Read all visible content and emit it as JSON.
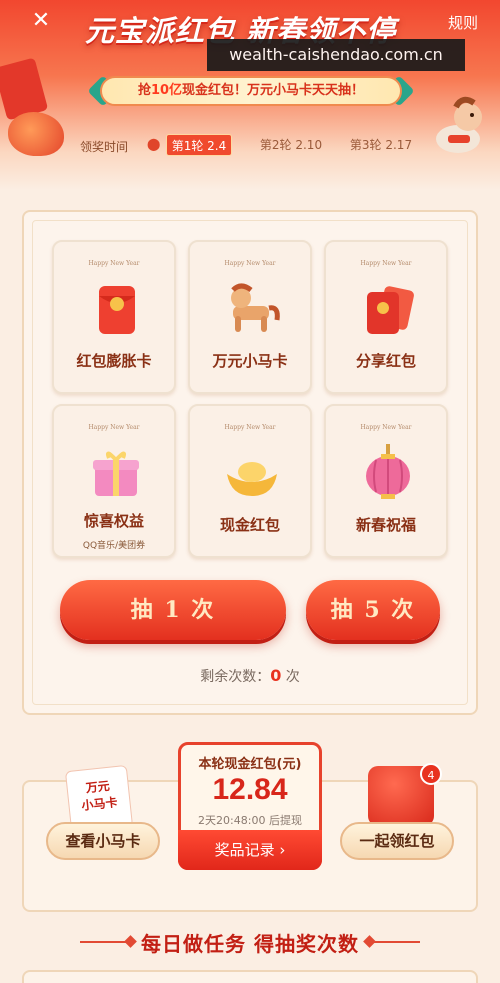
{
  "header": {
    "title": "元宝派红包 新春领不停",
    "rules_label": "规则",
    "watermark": "wealth-caishendao.com.cn",
    "banner_prefix": "抢",
    "banner_highlight": "10亿",
    "banner_suffix": "现金红包！万元小马卡天天抽！"
  },
  "rounds": {
    "label": "领奖时间",
    "items": [
      {
        "label": "第1轮 2.4",
        "active": true
      },
      {
        "label": "第2轮 2.10",
        "active": false
      },
      {
        "label": "第3轮 2.17",
        "active": false
      }
    ]
  },
  "prizes": [
    {
      "name": "红包膨胀卡",
      "hny": "Happy New Year",
      "sub": "",
      "icon": "red-envelope-icon"
    },
    {
      "name": "万元小马卡",
      "hny": "Happy New Year",
      "sub": "",
      "icon": "horse-icon"
    },
    {
      "name": "分享红包",
      "hny": "Happy New Year",
      "sub": "",
      "icon": "share-envelopes-icon"
    },
    {
      "name": "惊喜权益",
      "hny": "Happy New Year",
      "sub": "QQ音乐/美团券",
      "icon": "gift-box-icon"
    },
    {
      "name": "现金红包",
      "hny": "Happy New Year",
      "sub": "",
      "icon": "gold-ingot-icon"
    },
    {
      "name": "新春祝福",
      "hny": "Happy New Year",
      "sub": "",
      "icon": "lantern-icon"
    }
  ],
  "draw": {
    "once_label": "抽 1 次",
    "five_label": "抽 5 次",
    "remain_prefix": "剩余次数：",
    "remain_count": "0",
    "remain_suffix": " 次"
  },
  "round_cash": {
    "title": "本轮现金红包(元)",
    "amount": "12.84",
    "time_prefix": "2天20:48:00",
    "time_suffix": " 后提现",
    "records_label": "奖品记录"
  },
  "left_action": {
    "note_line1": "万元",
    "note_line2": "小马卡",
    "label": "查看小马卡"
  },
  "right_action": {
    "badge": "4",
    "label": "一起领红包"
  },
  "tasks": {
    "title": "每日做任务 得抽奖次数"
  }
}
